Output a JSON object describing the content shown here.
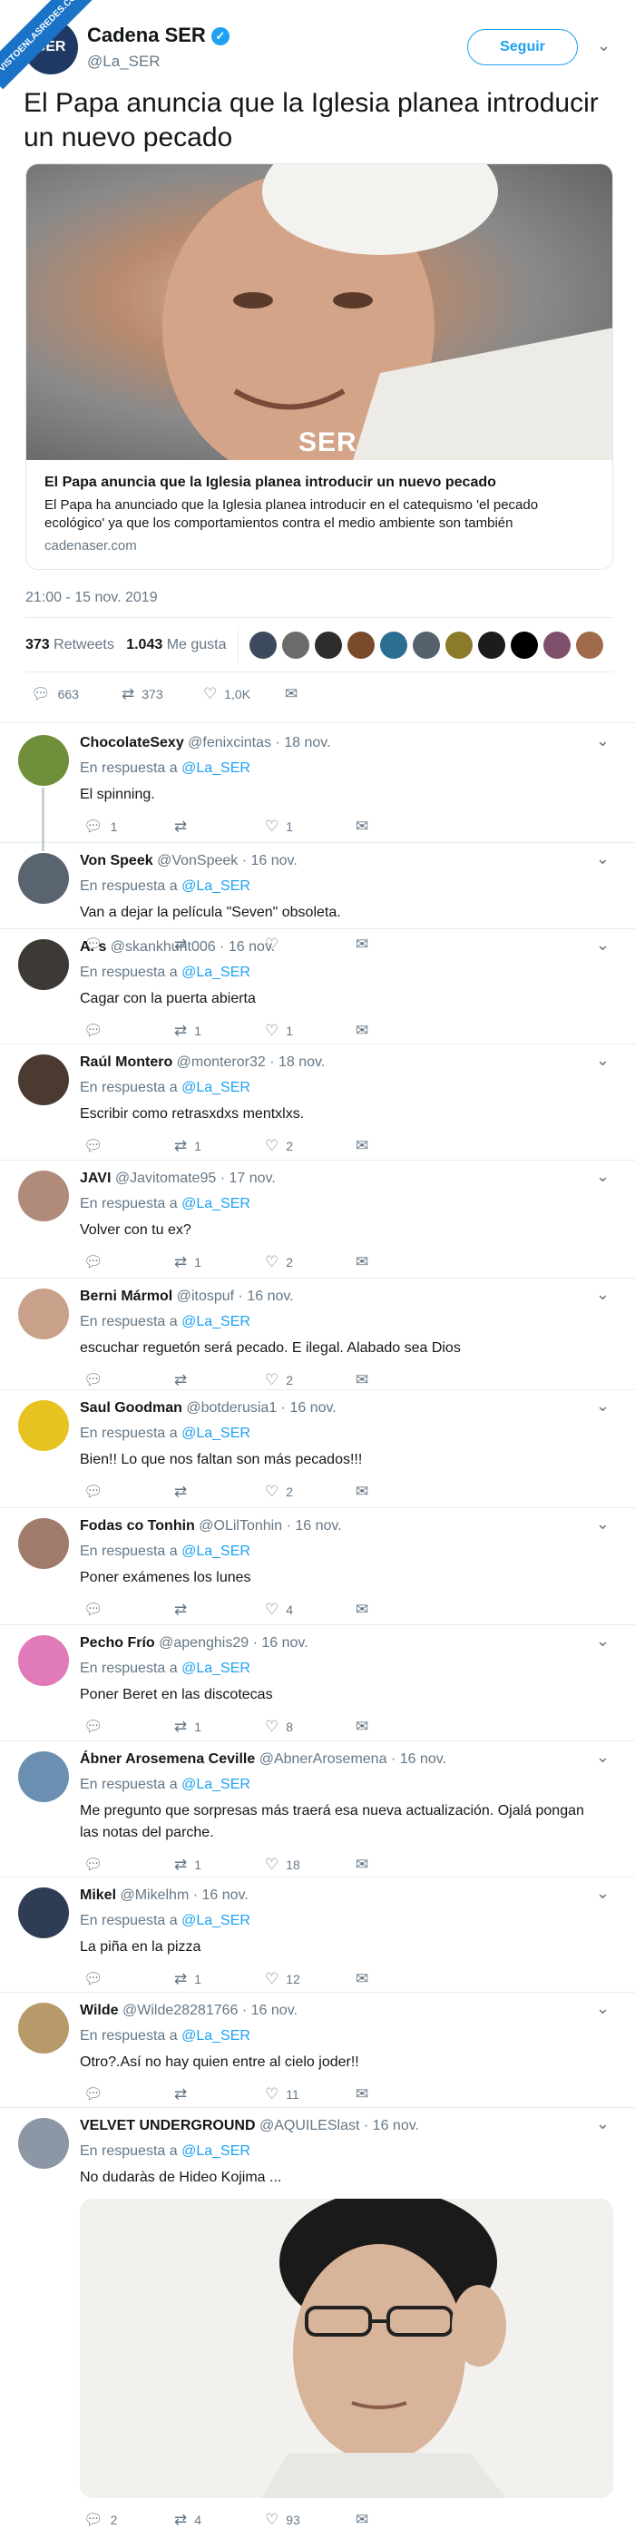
{
  "watermark": "VISTOENLASREDES.COM",
  "header": {
    "name": "Cadena SER",
    "handle": "@La_SER",
    "follow_label": "Seguir",
    "avatar_text": "SER"
  },
  "tweet": {
    "text": "El Papa anuncia que la Iglesia planea introducir un nuevo pecado"
  },
  "card": {
    "logo": "SER",
    "title": "El Papa anuncia que la Iglesia planea introducir un nuevo pecado",
    "description": "El Papa ha anunciado que la Iglesia planea introducir en el catequismo 'el pecado ecológico' ya que los comportamientos contra el medio ambiente son también",
    "domain": "cadenaser.com"
  },
  "timestamp": "21:00 - 15 nov. 2019",
  "stats": {
    "retweets": "373",
    "retweets_label": "Retweets",
    "likes": "1.043",
    "likes_label": "Me gusta"
  },
  "likers_colors": [
    "#3b4a5c",
    "#6b6b6b",
    "#2d2d2d",
    "#7a4b2a",
    "#2c6e8f",
    "#55616c",
    "#8a7a2a",
    "#1c1c1c",
    "#000000",
    "#7d4f6a",
    "#a06b4a"
  ],
  "main_actions": {
    "replies": "663",
    "retweets": "373",
    "likes": "1,0K"
  },
  "reply_to_label": "En respuesta a",
  "reply_to_handle": "@La_SER",
  "replies": [
    {
      "name": "ChocolateSexy",
      "handle": "@fenixcintas",
      "date": "· 18 nov.",
      "text": "El spinning.",
      "replies": "1",
      "retweets": "",
      "likes": "1",
      "color": "#6f8f3a"
    },
    {
      "name": "Von Speek",
      "handle": "@VonSpeek",
      "date": "· 16 nov.",
      "text": "Van a dejar la película \"Seven\" obsoleta.",
      "replies": "",
      "retweets": "",
      "likes": "",
      "color": "#5a6470"
    },
    {
      "name": "A. s",
      "handle": "@skankhunt006",
      "date": "· 16 nov.",
      "text": "Cagar con la puerta abierta",
      "replies": "",
      "retweets": "1",
      "likes": "1",
      "color": "#3d3a36"
    },
    {
      "name": "Raúl Montero",
      "handle": "@monteror32",
      "date": "· 18 nov.",
      "text": "Escribir como retrasxdxs mentxlxs.",
      "replies": "",
      "retweets": "1",
      "likes": "2",
      "color": "#4a3a30"
    },
    {
      "name": "JAVI",
      "handle": "@Javitomate95",
      "date": "· 17 nov.",
      "text": "Volver con tu ex?",
      "replies": "",
      "retweets": "1",
      "likes": "2",
      "color": "#b08b7a"
    },
    {
      "name": "Berni Mármol",
      "handle": "@itospuf",
      "date": "· 16 nov.",
      "text": "escuchar reguetón será pecado. E ilegal. Alabado sea Dios",
      "replies": "",
      "retweets": "",
      "likes": "2",
      "color": "#c9a08a"
    },
    {
      "name": "Saul Goodman",
      "handle": "@botderusia1",
      "date": "· 16 nov.",
      "text": "Bien!! Lo que nos faltan son más pecados!!!",
      "replies": "",
      "retweets": "",
      "likes": "2",
      "color": "#e6c320"
    },
    {
      "name": "Fodas co Tonhin",
      "handle": "@OLilTonhin",
      "date": "· 16 nov.",
      "text": "Poner exámenes los lunes",
      "replies": "",
      "retweets": "",
      "likes": "4",
      "color": "#a07a6a"
    },
    {
      "name": "Pecho Frío",
      "handle": "@apenghis29",
      "date": "· 16 nov.",
      "text": "Poner Beret en las discotecas",
      "replies": "",
      "retweets": "1",
      "likes": "8",
      "color": "#e07ab8"
    },
    {
      "name": "Ábner Arosemena Ceville",
      "handle": "@AbnerArosemena",
      "date": "· 16 nov.",
      "text": "Me pregunto que sorpresas más traerá esa nueva actualización. Ojalá pongan las notas del parche.",
      "replies": "",
      "retweets": "1",
      "likes": "18",
      "color": "#6a8fb0"
    },
    {
      "name": "Mikel",
      "handle": "@Mikelhm",
      "date": "· 16 nov.",
      "text": "La piña en la pizza",
      "replies": "",
      "retweets": "1",
      "likes": "12",
      "color": "#2e3c55"
    },
    {
      "name": "Wilde",
      "handle": "@Wilde28281766",
      "date": "· 16 nov.",
      "text": "Otro?.Así no hay quien entre al cielo joder!!",
      "replies": "",
      "retweets": "",
      "likes": "11",
      "color": "#b89a6a"
    },
    {
      "name": "VELVET UNDERGROUND",
      "handle": "@AQUILESlast",
      "date": "· 16 nov.",
      "text": "No dudaràs de Hideo Kojima ...",
      "replies": "2",
      "retweets": "4",
      "likes": "93",
      "color": "#8c96a4"
    }
  ]
}
